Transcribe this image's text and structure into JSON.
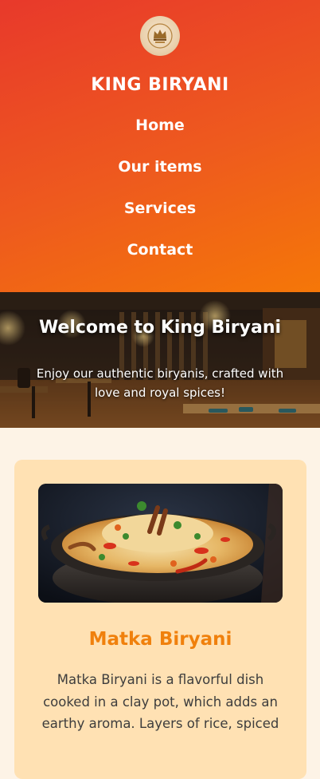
{
  "header": {
    "brand": "KING BIRYANI",
    "logo_icon": "king-crown-logo",
    "nav": [
      {
        "label": "Home"
      },
      {
        "label": "Our items"
      },
      {
        "label": "Services"
      },
      {
        "label": "Contact"
      }
    ],
    "gradient_colors": [
      "#e8392b",
      "#f57708"
    ]
  },
  "hero": {
    "title": "Welcome to King Biryani",
    "subtitle": "Enjoy our authentic biryanis, crafted with love and royal spices!"
  },
  "items": [
    {
      "name": "Matka Biryani",
      "image": "matka-biryani-photo",
      "description": "Matka Biryani is a flavorful dish cooked in a clay pot, which adds an earthy aroma. Layers of rice, spiced"
    }
  ],
  "colors": {
    "accent": "#f0800c",
    "card_bg": "#ffe1b3",
    "page_bg": "#fdf3e6"
  }
}
